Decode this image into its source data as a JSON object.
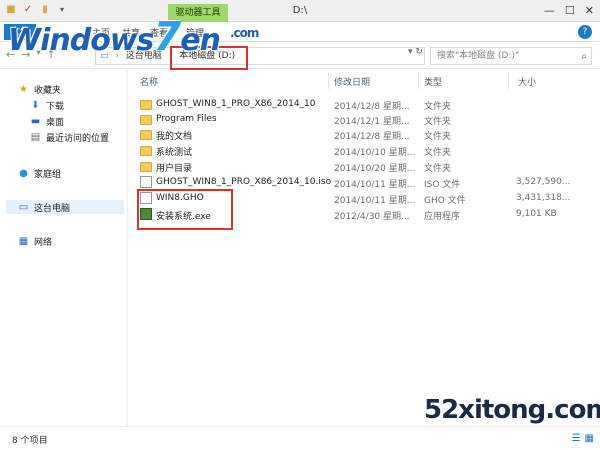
{
  "window": {
    "title": "D:\\",
    "tools_tab": "驱动器工具",
    "minimize": "—",
    "maximize": "☐",
    "close": "✕"
  },
  "ribbon": {
    "file": "文件",
    "tabs": [
      "主页",
      "共享",
      "查看",
      "管理"
    ],
    "help": "?"
  },
  "address": {
    "segments": [
      "这台电脑",
      "本地磁盘 (D:)"
    ],
    "search_placeholder": "搜索\"本地磁盘 (D:)\""
  },
  "sidebar": {
    "favorites": "收藏夹",
    "downloads": "下载",
    "desktop": "桌面",
    "recent": "最近访问的位置",
    "homegroup": "家庭组",
    "this_pc": "这台电脑",
    "network": "网络"
  },
  "columns": {
    "name": "名称",
    "modified": "修改日期",
    "type": "类型",
    "size": "大小"
  },
  "files": [
    {
      "name": "GHOST_WIN8_1_PRO_X86_2014_10",
      "date": "2014/12/8 星期...",
      "type": "文件夹",
      "size": "",
      "kind": "folder"
    },
    {
      "name": "Program Files",
      "date": "2014/12/1 星期...",
      "type": "文件夹",
      "size": "",
      "kind": "folder"
    },
    {
      "name": "我的文档",
      "date": "2014/12/8 星期...",
      "type": "文件夹",
      "size": "",
      "kind": "folder"
    },
    {
      "name": "系统测试",
      "date": "2014/10/10 星期...",
      "type": "文件夹",
      "size": "",
      "kind": "folder"
    },
    {
      "name": "用户目录",
      "date": "2014/10/20 星期...",
      "type": "文件夹",
      "size": "",
      "kind": "folder"
    },
    {
      "name": "GHOST_WIN8_1_PRO_X86_2014_10.iso",
      "date": "2014/10/11 星期...",
      "type": "ISO 文件",
      "size": "3,527,590...",
      "kind": "doc"
    },
    {
      "name": "WIN8.GHO",
      "date": "2014/10/11 星期...",
      "type": "GHO 文件",
      "size": "3,431,318...",
      "kind": "doc"
    },
    {
      "name": "安装系统.exe",
      "date": "2012/4/30 星期...",
      "type": "应用程序",
      "size": "9,101 KB",
      "kind": "exe"
    }
  ],
  "status": {
    "count": "8 个项目"
  },
  "watermarks": {
    "logo_left": "Windows",
    "logo_seven": "7",
    "logo_right": "en",
    "logo_com": ".com",
    "site": "52xitong.com"
  },
  "colors": {
    "accent": "#1979ca",
    "tools_tab": "#9fd86a",
    "highlight": "#d9342b"
  }
}
